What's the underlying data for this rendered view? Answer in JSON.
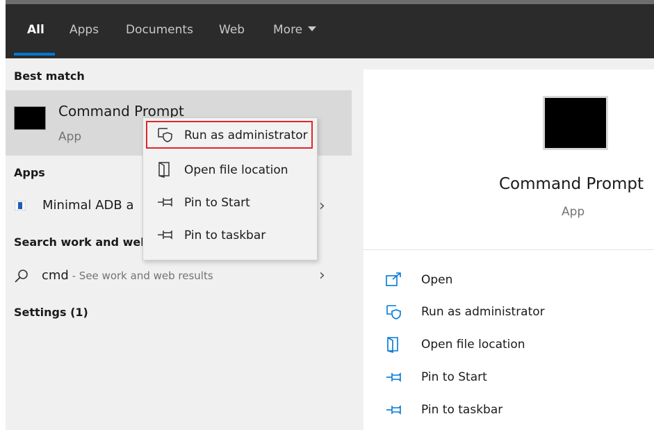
{
  "tabs": [
    {
      "label": "All",
      "active": true
    },
    {
      "label": "Apps",
      "active": false
    },
    {
      "label": "Documents",
      "active": false
    },
    {
      "label": "Web",
      "active": false
    },
    {
      "label": "More",
      "active": false
    }
  ],
  "best_match": {
    "heading": "Best match",
    "title": "Command Prompt",
    "subtitle": "App"
  },
  "apps": {
    "heading": "Apps",
    "item": "Minimal ADB a"
  },
  "search_web": {
    "heading": "Search work and web",
    "query": "cmd",
    "hint": " - See work and web results"
  },
  "settings": {
    "heading": "Settings (1)"
  },
  "context_menu": [
    {
      "label": "Run as administrator",
      "icon": "shield-icon",
      "highlighted": true
    },
    {
      "label": "Open file location",
      "icon": "folder-icon",
      "highlighted": false
    },
    {
      "label": "Pin to Start",
      "icon": "pin-icon",
      "highlighted": false
    },
    {
      "label": "Pin to taskbar",
      "icon": "pin-icon",
      "highlighted": false
    }
  ],
  "preview": {
    "title": "Command Prompt",
    "subtitle": "App",
    "actions": [
      {
        "label": "Open",
        "icon": "open-icon"
      },
      {
        "label": "Run as administrator",
        "icon": "shield-icon"
      },
      {
        "label": "Open file location",
        "icon": "folder-icon"
      },
      {
        "label": "Pin to Start",
        "icon": "pin-icon"
      },
      {
        "label": "Pin to taskbar",
        "icon": "pin-icon"
      }
    ]
  },
  "colors": {
    "accent": "#0078d7",
    "highlight_border": "#e0262a",
    "topbar": "#2b2b2b"
  }
}
